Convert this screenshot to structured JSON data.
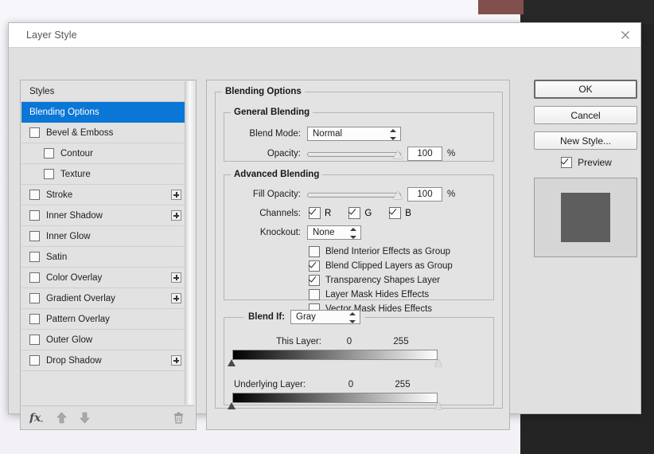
{
  "window": {
    "title": "Layer Style",
    "close_icon": "close-icon"
  },
  "styles_panel": {
    "items": [
      {
        "label": "Styles",
        "type": "header",
        "checkbox": false,
        "checked": false,
        "selected": false,
        "indent": false,
        "plus": false
      },
      {
        "label": "Blending Options",
        "type": "header",
        "checkbox": false,
        "checked": false,
        "selected": true,
        "indent": false,
        "plus": false
      },
      {
        "label": "Bevel & Emboss",
        "type": "effect",
        "checkbox": true,
        "checked": false,
        "selected": false,
        "indent": false,
        "plus": false
      },
      {
        "label": "Contour",
        "type": "sub",
        "checkbox": true,
        "checked": false,
        "selected": false,
        "indent": true,
        "plus": false
      },
      {
        "label": "Texture",
        "type": "sub",
        "checkbox": true,
        "checked": false,
        "selected": false,
        "indent": true,
        "plus": false
      },
      {
        "label": "Stroke",
        "type": "effect",
        "checkbox": true,
        "checked": false,
        "selected": false,
        "indent": false,
        "plus": true
      },
      {
        "label": "Inner Shadow",
        "type": "effect",
        "checkbox": true,
        "checked": false,
        "selected": false,
        "indent": false,
        "plus": true
      },
      {
        "label": "Inner Glow",
        "type": "effect",
        "checkbox": true,
        "checked": false,
        "selected": false,
        "indent": false,
        "plus": false
      },
      {
        "label": "Satin",
        "type": "effect",
        "checkbox": true,
        "checked": false,
        "selected": false,
        "indent": false,
        "plus": false
      },
      {
        "label": "Color Overlay",
        "type": "effect",
        "checkbox": true,
        "checked": false,
        "selected": false,
        "indent": false,
        "plus": true
      },
      {
        "label": "Gradient Overlay",
        "type": "effect",
        "checkbox": true,
        "checked": false,
        "selected": false,
        "indent": false,
        "plus": true
      },
      {
        "label": "Pattern Overlay",
        "type": "effect",
        "checkbox": true,
        "checked": false,
        "selected": false,
        "indent": false,
        "plus": false
      },
      {
        "label": "Outer Glow",
        "type": "effect",
        "checkbox": true,
        "checked": false,
        "selected": false,
        "indent": false,
        "plus": false
      },
      {
        "label": "Drop Shadow",
        "type": "effect",
        "checkbox": true,
        "checked": false,
        "selected": false,
        "indent": false,
        "plus": true
      }
    ],
    "toolbar": {
      "fx_icon": "fx-icon",
      "up_icon": "arrow-up-icon",
      "down_icon": "arrow-down-icon",
      "trash_icon": "trash-icon"
    }
  },
  "options": {
    "section_title": "Blending Options",
    "general": {
      "title": "General Blending",
      "blend_mode_label": "Blend Mode:",
      "blend_mode_value": "Normal",
      "opacity_label": "Opacity:",
      "opacity_value": "100",
      "opacity_unit": "%"
    },
    "advanced": {
      "title": "Advanced Blending",
      "fill_opacity_label": "Fill Opacity:",
      "fill_opacity_value": "100",
      "fill_opacity_unit": "%",
      "channels_label": "Channels:",
      "channels": [
        {
          "label": "R",
          "checked": true
        },
        {
          "label": "G",
          "checked": true
        },
        {
          "label": "B",
          "checked": true
        }
      ],
      "knockout_label": "Knockout:",
      "knockout_value": "None",
      "checkboxes": [
        {
          "label": "Blend Interior Effects as Group",
          "checked": false
        },
        {
          "label": "Blend Clipped Layers as Group",
          "checked": true
        },
        {
          "label": "Transparency Shapes Layer",
          "checked": true
        },
        {
          "label": "Layer Mask Hides Effects",
          "checked": false
        },
        {
          "label": "Vector Mask Hides Effects",
          "checked": false
        }
      ]
    },
    "blend_if": {
      "label": "Blend If:",
      "value": "Gray",
      "sliders": [
        {
          "label": "This Layer:",
          "min": "0",
          "max": "255"
        },
        {
          "label": "Underlying Layer:",
          "min": "0",
          "max": "255"
        }
      ]
    }
  },
  "buttons": {
    "ok": "OK",
    "cancel": "Cancel",
    "new_style": "New Style...",
    "preview_label": "Preview",
    "preview_checked": true
  },
  "colors": {
    "accent": "#0a76d5",
    "dialog_bg": "#e0e0e0",
    "panel_bg": "#e3e3e3",
    "preview_swatch": "#5e5e5e",
    "preview_bg": "#d6d6d6",
    "desktop_dark": "#242424",
    "desktop_red": "#82504c"
  }
}
